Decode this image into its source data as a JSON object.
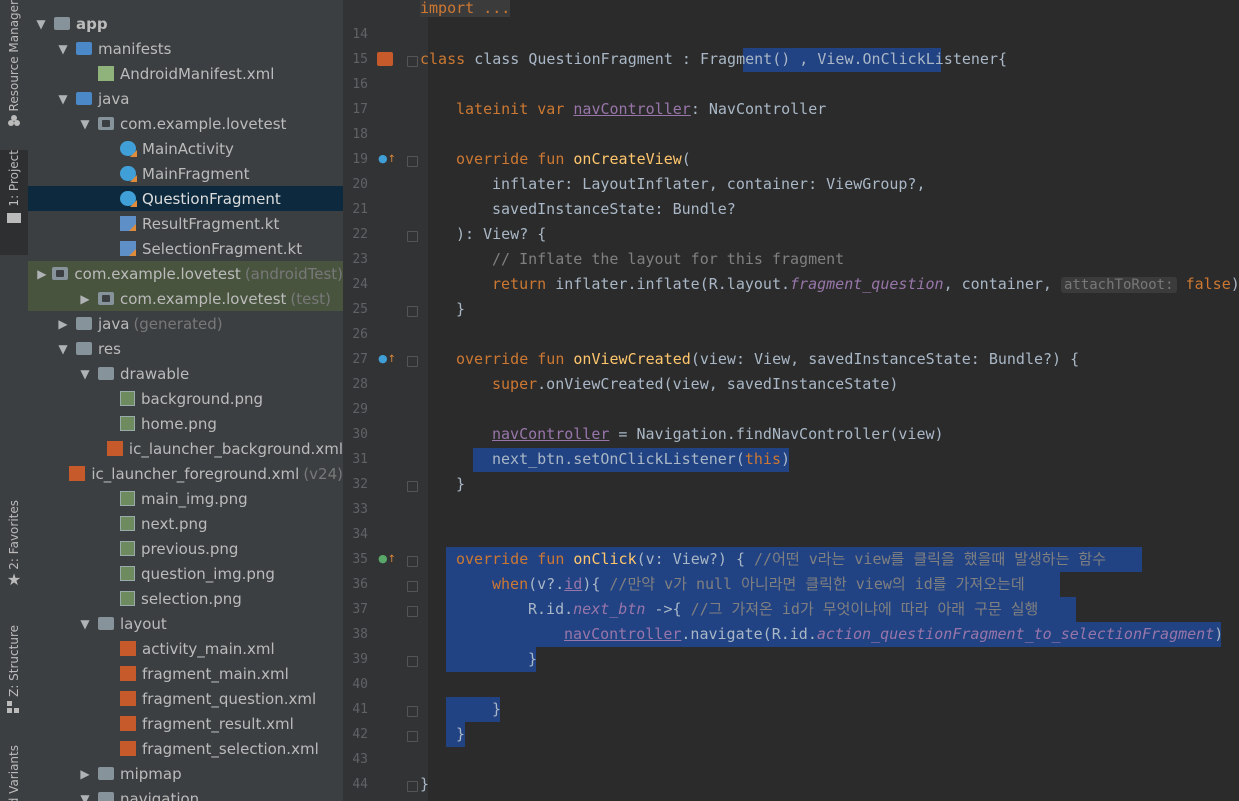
{
  "sidebar_strip": {
    "resource_manager": "Resource Manager",
    "project": "1: Project",
    "favorites": "2: Favorites",
    "structure": "Z: Structure",
    "build_variants": "Build Variants"
  },
  "project_tree": [
    {
      "label": "app",
      "indent": 0,
      "arrow": "▼",
      "icon": "folder-icon",
      "bold": true
    },
    {
      "label": "manifests",
      "indent": 1,
      "arrow": "▼",
      "icon": "folder-blue-icon"
    },
    {
      "label": "AndroidManifest.xml",
      "indent": 2,
      "arrow": "",
      "icon": "manifest-icon"
    },
    {
      "label": "java",
      "indent": 1,
      "arrow": "▼",
      "icon": "folder-blue-icon"
    },
    {
      "label": "com.example.lovetest",
      "indent": 2,
      "arrow": "▼",
      "icon": "package-icon"
    },
    {
      "label": "MainActivity",
      "indent": 3,
      "arrow": "",
      "icon": "kotlin-class-icon"
    },
    {
      "label": "MainFragment",
      "indent": 3,
      "arrow": "",
      "icon": "kotlin-class-icon"
    },
    {
      "label": "QuestionFragment",
      "indent": 3,
      "arrow": "",
      "icon": "kotlin-class-icon",
      "selected": true
    },
    {
      "label": "ResultFragment.kt",
      "indent": 3,
      "arrow": "",
      "icon": "kotlin-file-icon"
    },
    {
      "label": "SelectionFragment.kt",
      "indent": 3,
      "arrow": "",
      "icon": "kotlin-file-icon"
    },
    {
      "label": "com.example.lovetest",
      "suffix": "(androidTest)",
      "indent": 2,
      "arrow": "▶",
      "icon": "package-icon",
      "test": true
    },
    {
      "label": "com.example.lovetest",
      "suffix": "(test)",
      "indent": 2,
      "arrow": "▶",
      "icon": "package-icon",
      "test": true
    },
    {
      "label": "java",
      "suffix": "(generated)",
      "indent": 1,
      "arrow": "▶",
      "icon": "folder-icon"
    },
    {
      "label": "res",
      "indent": 1,
      "arrow": "▼",
      "icon": "folder-icon"
    },
    {
      "label": "drawable",
      "indent": 2,
      "arrow": "▼",
      "icon": "folder-icon"
    },
    {
      "label": "background.png",
      "indent": 3,
      "arrow": "",
      "icon": "png-icon"
    },
    {
      "label": "home.png",
      "indent": 3,
      "arrow": "",
      "icon": "png-icon"
    },
    {
      "label": "ic_launcher_background.xml",
      "indent": 3,
      "arrow": "",
      "icon": "xml-icon"
    },
    {
      "label": "ic_launcher_foreground.xml",
      "suffix": "(v24)",
      "indent": 3,
      "arrow": "",
      "icon": "xml-icon"
    },
    {
      "label": "main_img.png",
      "indent": 3,
      "arrow": "",
      "icon": "png-icon"
    },
    {
      "label": "next.png",
      "indent": 3,
      "arrow": "",
      "icon": "png-icon"
    },
    {
      "label": "previous.png",
      "indent": 3,
      "arrow": "",
      "icon": "png-icon"
    },
    {
      "label": "question_img.png",
      "indent": 3,
      "arrow": "",
      "icon": "png-icon"
    },
    {
      "label": "selection.png",
      "indent": 3,
      "arrow": "",
      "icon": "png-icon"
    },
    {
      "label": "layout",
      "indent": 2,
      "arrow": "▼",
      "icon": "folder-icon"
    },
    {
      "label": "activity_main.xml",
      "indent": 3,
      "arrow": "",
      "icon": "xml-icon"
    },
    {
      "label": "fragment_main.xml",
      "indent": 3,
      "arrow": "",
      "icon": "xml-icon"
    },
    {
      "label": "fragment_question.xml",
      "indent": 3,
      "arrow": "",
      "icon": "xml-icon"
    },
    {
      "label": "fragment_result.xml",
      "indent": 3,
      "arrow": "",
      "icon": "xml-icon"
    },
    {
      "label": "fragment_selection.xml",
      "indent": 3,
      "arrow": "",
      "icon": "xml-icon"
    },
    {
      "label": "mipmap",
      "indent": 2,
      "arrow": "▶",
      "icon": "folder-icon"
    },
    {
      "label": "navigation",
      "indent": 2,
      "arrow": "▼",
      "icon": "folder-icon"
    }
  ],
  "editor": {
    "top_line": "import ...",
    "line_numbers": [
      "14",
      "15",
      "16",
      "17",
      "18",
      "19",
      "20",
      "21",
      "22",
      "23",
      "24",
      "25",
      "26",
      "27",
      "28",
      "29",
      "30",
      "31",
      "32",
      "33",
      "34",
      "35",
      "36",
      "37",
      "38",
      "39",
      "40",
      "41",
      "42",
      "43",
      "44"
    ],
    "code": {
      "l15_a": "class QuestionFragment : Fragment() ",
      "l15_b": ", View.OnClickListener",
      "l15_c": "{",
      "l17_kw": "lateinit var ",
      "l17_prop": "navController",
      "l17_rest": ": NavController",
      "l19_kw": "override fun ",
      "l19_fn": "onCreateView",
      "l19_rest": "(",
      "l20": "inflater: LayoutInflater, container: ViewGroup?,",
      "l21": "savedInstanceState: Bundle?",
      "l22": "): View? {",
      "l23": "// Inflate the layout for this fragment",
      "l24_kw": "return ",
      "l24_a": "inflater.inflate(R.layout.",
      "l24_ital": "fragment_question",
      "l24_b": ", container, ",
      "l24_hint": "attachToRoot:",
      "l24_false": "false",
      "l24_c": ")",
      "l25": "}",
      "l27_kw": "override fun ",
      "l27_fn": "onViewCreated",
      "l27_rest": "(view: View, savedInstanceState: Bundle?) {",
      "l28_kw": "super",
      "l28_rest": ".onViewCreated(view, savedInstanceState)",
      "l30_prop": "navController",
      "l30_rest": " = Navigation.findNavController(view)",
      "l31_a": "next_btn.setOnClickListener(",
      "l31_kw": "this",
      "l31_b": ")",
      "l32": "}",
      "l35_kw": "override fun ",
      "l35_fn": "onClick",
      "l35_rest": "(v: View?) { ",
      "l35_cm": "//어떤 v라는 view를 클릭을 했을때 발생하는 함수",
      "l36_kw": "when",
      "l36_a": "(v?.",
      "l36_prop": "id",
      "l36_b": "){ ",
      "l36_cm": "//만약 v가 null 아니라면 클릭한 view의 id를 가져오는데",
      "l37_a": "R.id.",
      "l37_ital": "next_btn",
      "l37_b": " ->{ ",
      "l37_cm": "//그 가져온 id가 무엇이냐에 따라 아래 구문 실행",
      "l38_prop": "navController",
      "l38_a": ".navigate(R.id.",
      "l38_ital": "action_questionFragment_to_selectionFragment",
      "l38_b": ")",
      "l39": "}",
      "l41": "}",
      "l42": "}",
      "l44": "}"
    }
  }
}
